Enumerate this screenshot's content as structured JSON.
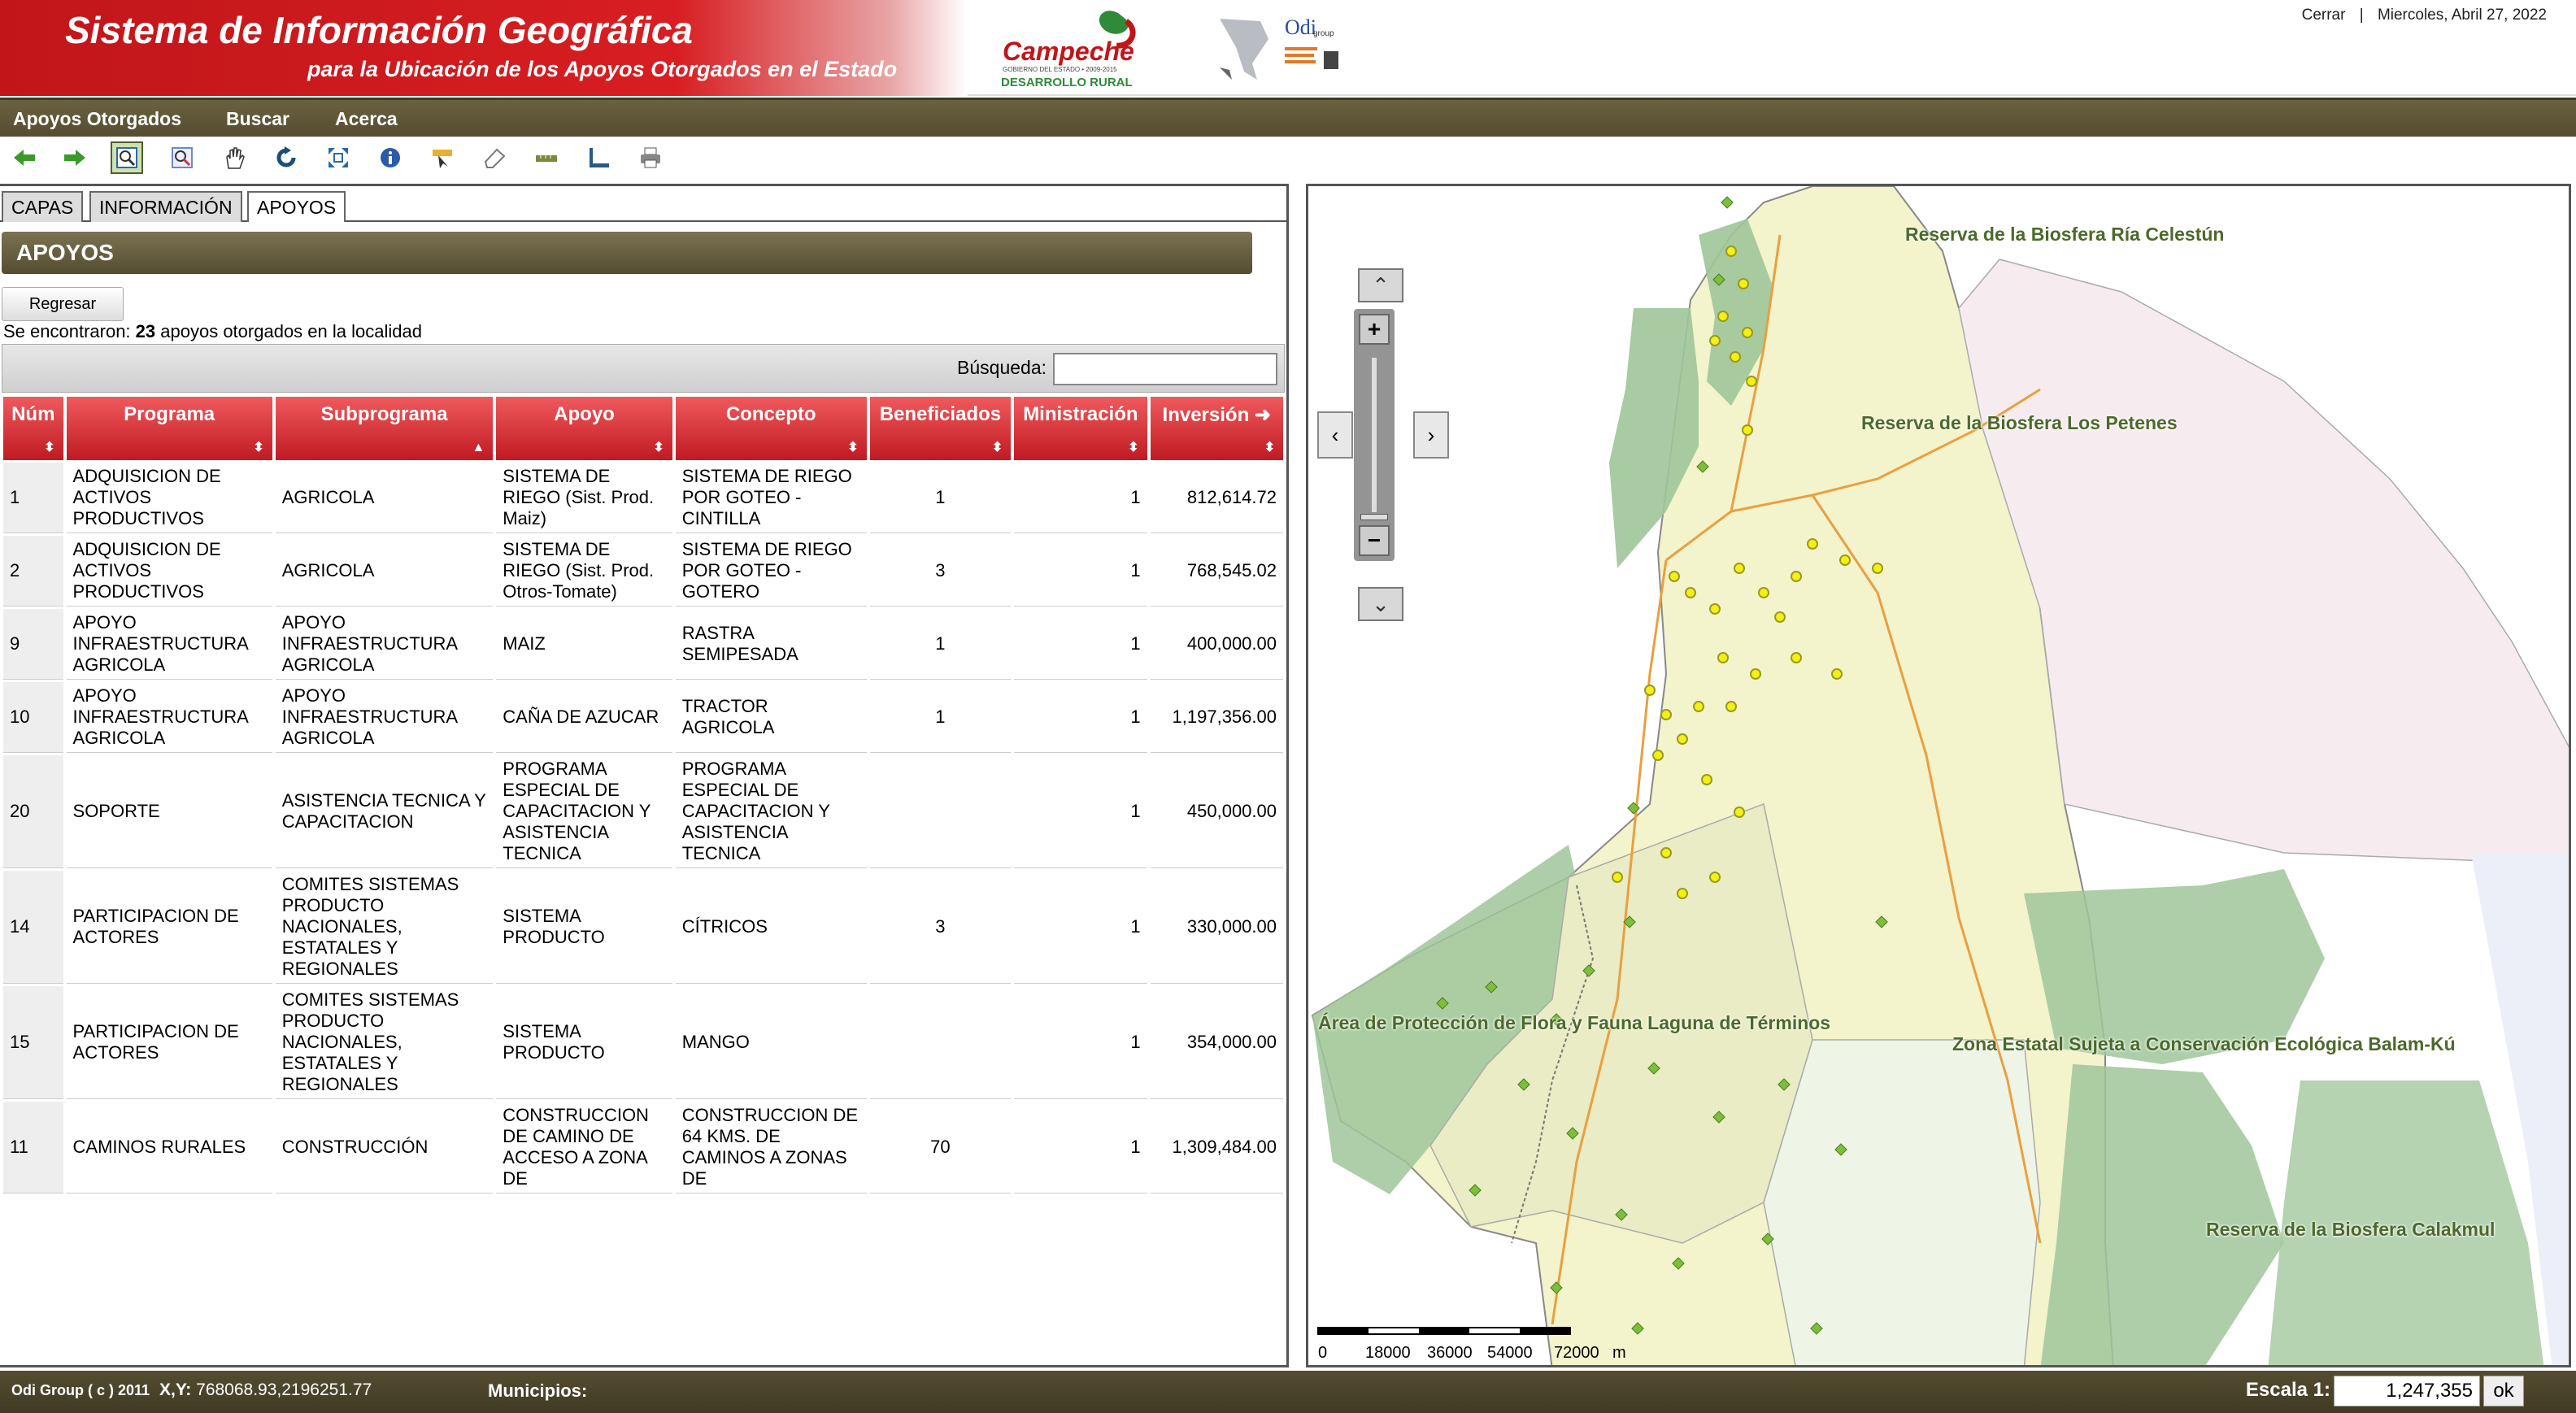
{
  "header": {
    "title": "Sistema de Información Geográfica",
    "subtitle": "para la Ubicación de los Apoyos Otorgados en el Estado",
    "logo_campeche": "Campeche",
    "logo_campeche_sub": "GOBIERNO DEL ESTADO • 2009-2015",
    "logo_desarrollo": "DESARROLLO RURAL",
    "logo_odi": "Odi",
    "logo_odi_group": "group",
    "close_label": "Cerrar",
    "separator": "|",
    "date": "Miercoles, Abril 27, 2022"
  },
  "menu": {
    "items": [
      "Apoyos Otorgados",
      "Buscar",
      "Acerca"
    ]
  },
  "toolbar": {
    "icons": [
      "back-arrow-icon",
      "forward-arrow-icon",
      "zoom-in-box-icon",
      "zoom-out-icon",
      "pan-hand-icon",
      "refresh-icon",
      "full-extent-icon",
      "info-icon",
      "select-tool-icon",
      "eraser-icon",
      "measure-line-icon",
      "measure-area-icon",
      "print-icon"
    ]
  },
  "tabs": [
    "CAPAS",
    "INFORMACIÓN",
    "APOYOS"
  ],
  "panel": {
    "section_title": "APOYOS",
    "back_button": "Regresar",
    "found_prefix": "Se encontraron: ",
    "found_count": "23",
    "found_suffix": " apoyos otorgados en la localidad",
    "search_label": "Búsqueda:",
    "search_value": ""
  },
  "table": {
    "columns": [
      "Núm",
      "Programa",
      "Subprograma",
      "Apoyo",
      "Concepto",
      "Beneficiados",
      "Ministración",
      "Inversión"
    ],
    "rows": [
      [
        "1",
        "ADQUISICION DE ACTIVOS PRODUCTIVOS",
        "AGRICOLA",
        "SISTEMA DE RIEGO (Sist. Prod. Maiz)",
        "SISTEMA DE RIEGO POR GOTEO - CINTILLA",
        "1",
        "1",
        "812,614.72"
      ],
      [
        "2",
        "ADQUISICION DE ACTIVOS PRODUCTIVOS",
        "AGRICOLA",
        "SISTEMA DE RIEGO (Sist. Prod. Otros-Tomate)",
        "SISTEMA DE RIEGO POR GOTEO - GOTERO",
        "3",
        "1",
        "768,545.02"
      ],
      [
        "9",
        "APOYO INFRAESTRUCTURA AGRICOLA",
        "APOYO INFRAESTRUCTURA AGRICOLA",
        "MAIZ",
        "RASTRA SEMIPESADA",
        "1",
        "1",
        "400,000.00"
      ],
      [
        "10",
        "APOYO INFRAESTRUCTURA AGRICOLA",
        "APOYO INFRAESTRUCTURA AGRICOLA",
        "CAÑA DE AZUCAR",
        "TRACTOR AGRICOLA",
        "1",
        "1",
        "1,197,356.00"
      ],
      [
        "20",
        "SOPORTE",
        "ASISTENCIA TECNICA Y CAPACITACION",
        "PROGRAMA ESPECIAL DE CAPACITACION Y ASISTENCIA TECNICA",
        "PROGRAMA ESPECIAL DE CAPACITACION Y ASISTENCIA TECNICA",
        "",
        "1",
        "450,000.00"
      ],
      [
        "14",
        "PARTICIPACION DE ACTORES",
        "COMITES SISTEMAS PRODUCTO NACIONALES, ESTATALES Y REGIONALES",
        "SISTEMA PRODUCTO",
        "CÍTRICOS",
        "3",
        "1",
        "330,000.00"
      ],
      [
        "15",
        "PARTICIPACION DE ACTORES",
        "COMITES SISTEMAS PRODUCTO NACIONALES, ESTATALES Y REGIONALES",
        "SISTEMA PRODUCTO",
        "MANGO",
        "",
        "1",
        "354,000.00"
      ],
      [
        "11",
        "CAMINOS RURALES",
        "CONSTRUCCIÓN",
        "CONSTRUCCION DE CAMINO DE ACCESO A ZONA DE",
        "CONSTRUCCION DE 64 KMS. DE CAMINOS A ZONAS DE",
        "70",
        "1",
        "1,309,484.00"
      ]
    ]
  },
  "map": {
    "labels": {
      "celestun": "Reserva de la Biosfera  Ría Celestún",
      "petenes": "Reserva de la Biosfera  Los Petenes",
      "terminos": "Área de Protección de Flora y Fauna  Laguna de Términos",
      "balamku": "Zona Estatal Sujeta a Conservación Ecológica Balam-Kú",
      "calakmul": "Reserva de la Biosfera  Calakmul"
    },
    "scale_ticks": [
      "0",
      "18000",
      "36000",
      "54000",
      "72000"
    ],
    "scale_unit": "m",
    "colors": {
      "reserve": "#9fc59a",
      "municipio_light": "#f4f4c8",
      "road": "#e8a040",
      "point_yellow": "#f5f014",
      "point_green": "#7bbf3a"
    }
  },
  "footer": {
    "copyright": "Odi Group ( c ) 2011",
    "xy_label": "X,Y:",
    "xy_value": "768068.93,2196251.77",
    "municipios_label": "Municipios:",
    "escala_label": "Escala 1:",
    "escala_value": "1,247,355",
    "ok_label": "ok"
  }
}
